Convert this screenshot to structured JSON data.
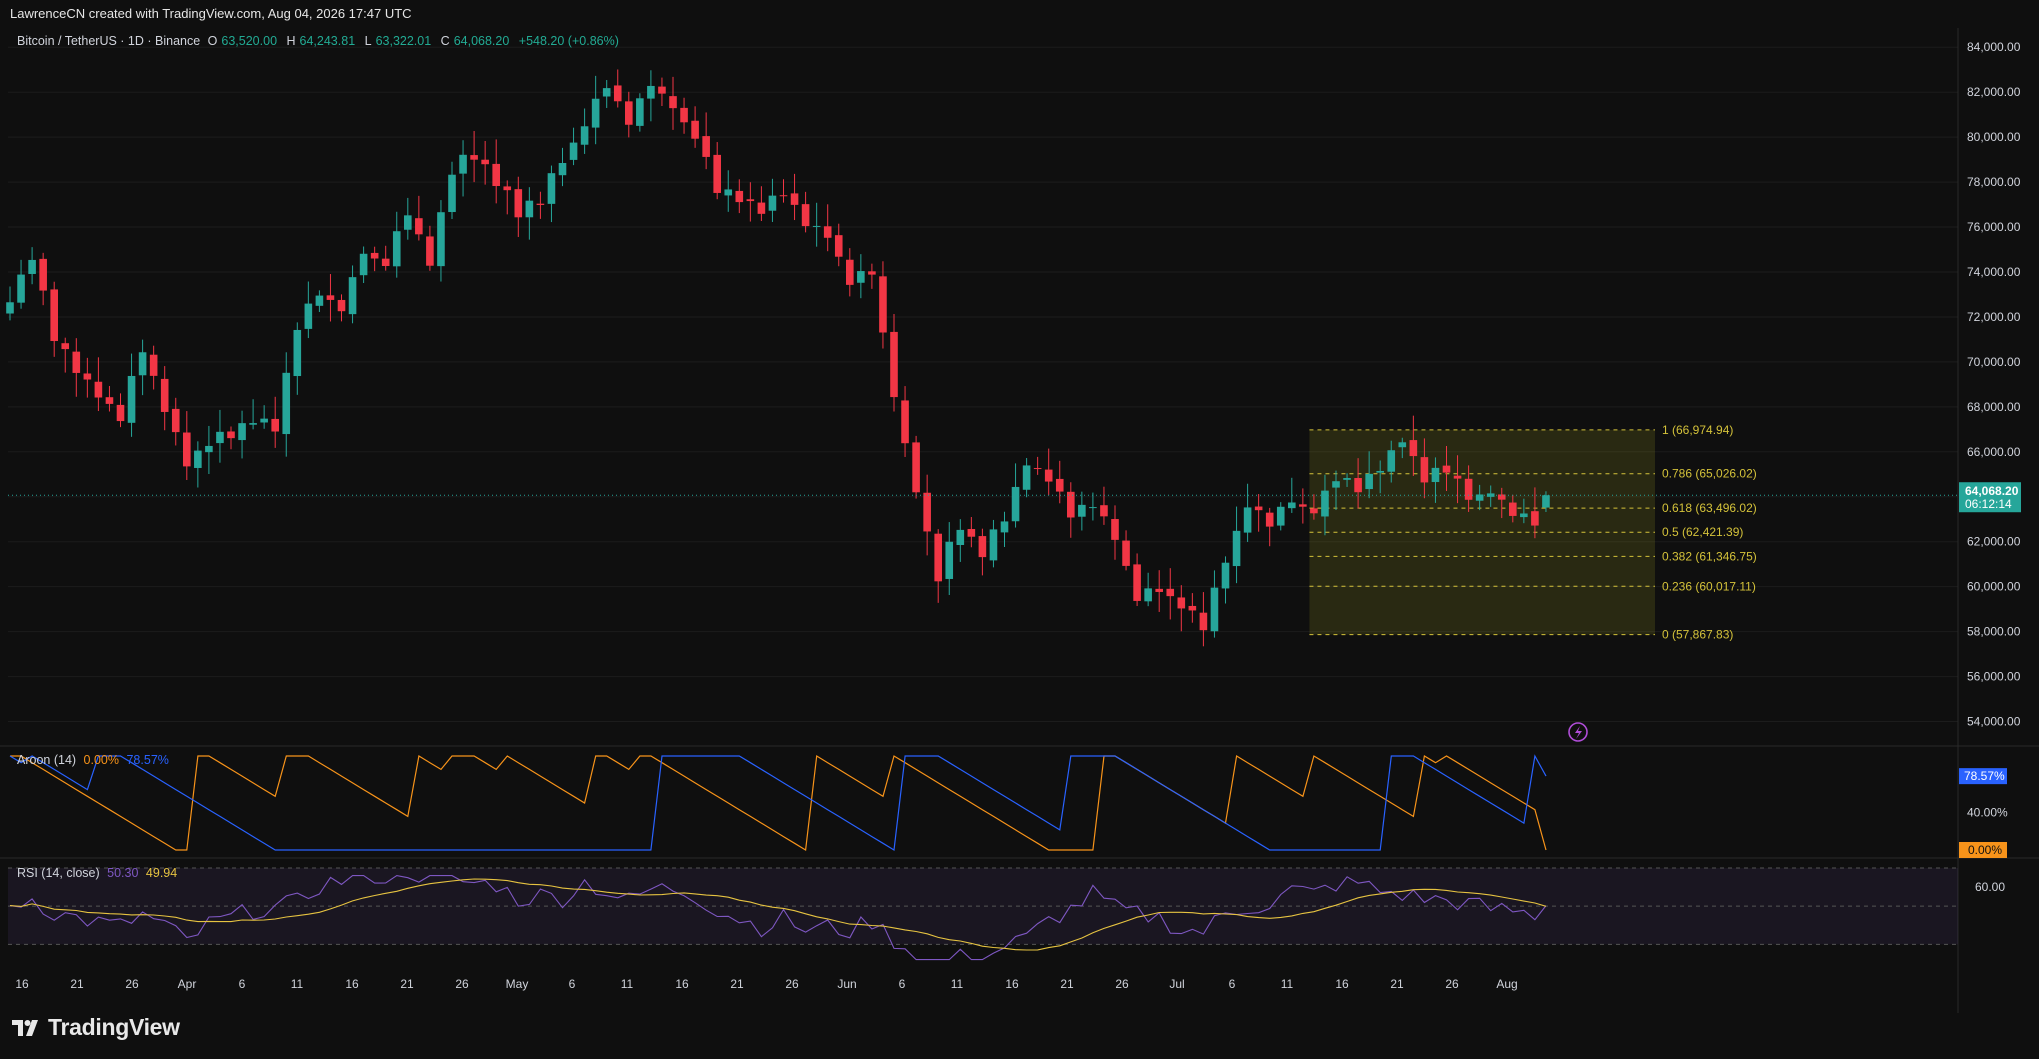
{
  "header": {
    "attribution": "LawrenceCN created with TradingView.com, Aug 04, 2026 17:47 UTC"
  },
  "legend": {
    "symbol": "Bitcoin / TetherUS · 1D · Binance",
    "open_label": "O",
    "open": "63,520.00",
    "high_label": "H",
    "high": "64,243.81",
    "low_label": "L",
    "low": "63,322.01",
    "close_label": "C",
    "close": "64,068.20",
    "change": "+548.20 (+0.86%)"
  },
  "price_badge": {
    "price": "64,068.20",
    "countdown": "06:12:14"
  },
  "aroon": {
    "label": "Aroon (14)",
    "up_value": "0.00%",
    "down_value": "78.57%",
    "axis_label": "40.00%",
    "badge_down": "78.57%",
    "badge_up": "0.00%"
  },
  "rsi": {
    "label": "RSI (14, close)",
    "rsi_value": "50.30",
    "ma_value": "49.94",
    "axis_label": "60.00"
  },
  "logo": {
    "text": "TradingView"
  },
  "colors": {
    "up": "#26a69a",
    "down": "#f23645",
    "aroon_up": "#f7931a",
    "aroon_down": "#2962ff",
    "rsi": "#7e57c2",
    "rsi_ma": "#e6c341",
    "fib": "#d4c23a"
  },
  "chart_data": [
    {
      "type": "candlestick",
      "title": "Bitcoin / TetherUS · 1D · Binance",
      "ylim": [
        53000,
        84500
      ],
      "y_ticks": [
        "84,000.00",
        "82,000.00",
        "80,000.00",
        "78,000.00",
        "76,000.00",
        "74,000.00",
        "72,000.00",
        "70,000.00",
        "68,000.00",
        "66,000.00",
        "62,000.00",
        "60,000.00",
        "58,000.00",
        "56,000.00",
        "54,000.00"
      ],
      "x_ticks": [
        "16",
        "21",
        "26",
        "Apr",
        "6",
        "11",
        "16",
        "21",
        "26",
        "May",
        "6",
        "11",
        "16",
        "21",
        "26",
        "Jun",
        "6",
        "11",
        "16",
        "21",
        "26",
        "Jul",
        "6",
        "11",
        "16",
        "21",
        "26",
        "Aug"
      ],
      "close_anchors": [
        {
          "d": 0,
          "c": 72800
        },
        {
          "d": 2,
          "c": 74800
        },
        {
          "d": 4,
          "c": 71000
        },
        {
          "d": 6,
          "c": 69800
        },
        {
          "d": 8,
          "c": 68500
        },
        {
          "d": 10,
          "c": 67600
        },
        {
          "d": 12,
          "c": 70500
        },
        {
          "d": 14,
          "c": 67800
        },
        {
          "d": 16,
          "c": 65500
        },
        {
          "d": 18,
          "c": 66300
        },
        {
          "d": 20,
          "c": 66800
        },
        {
          "d": 22,
          "c": 67500
        },
        {
          "d": 24,
          "c": 67200
        },
        {
          "d": 26,
          "c": 71500
        },
        {
          "d": 28,
          "c": 73200
        },
        {
          "d": 30,
          "c": 72300
        },
        {
          "d": 32,
          "c": 74900
        },
        {
          "d": 34,
          "c": 74300
        },
        {
          "d": 36,
          "c": 76800
        },
        {
          "d": 38,
          "c": 74300
        },
        {
          "d": 40,
          "c": 78600
        },
        {
          "d": 42,
          "c": 79200
        },
        {
          "d": 44,
          "c": 78100
        },
        {
          "d": 46,
          "c": 76600
        },
        {
          "d": 48,
          "c": 77200
        },
        {
          "d": 50,
          "c": 78900
        },
        {
          "d": 52,
          "c": 80600
        },
        {
          "d": 54,
          "c": 82300
        },
        {
          "d": 56,
          "c": 80600
        },
        {
          "d": 58,
          "c": 82500
        },
        {
          "d": 60,
          "c": 81300
        },
        {
          "d": 62,
          "c": 80000
        },
        {
          "d": 64,
          "c": 77800
        },
        {
          "d": 66,
          "c": 77400
        },
        {
          "d": 68,
          "c": 76800
        },
        {
          "d": 70,
          "c": 77500
        },
        {
          "d": 72,
          "c": 76200
        },
        {
          "d": 74,
          "c": 75800
        },
        {
          "d": 76,
          "c": 73500
        },
        {
          "d": 78,
          "c": 73900
        },
        {
          "d": 80,
          "c": 68500
        },
        {
          "d": 82,
          "c": 64200
        },
        {
          "d": 84,
          "c": 60500
        },
        {
          "d": 86,
          "c": 62800
        },
        {
          "d": 88,
          "c": 61600
        },
        {
          "d": 90,
          "c": 63000
        },
        {
          "d": 92,
          "c": 65500
        },
        {
          "d": 94,
          "c": 64800
        },
        {
          "d": 96,
          "c": 63300
        },
        {
          "d": 98,
          "c": 63800
        },
        {
          "d": 100,
          "c": 62300
        },
        {
          "d": 102,
          "c": 59500
        },
        {
          "d": 104,
          "c": 60000
        },
        {
          "d": 106,
          "c": 59100
        },
        {
          "d": 108,
          "c": 58300
        },
        {
          "d": 110,
          "c": 61200
        },
        {
          "d": 112,
          "c": 63600
        },
        {
          "d": 114,
          "c": 62700
        },
        {
          "d": 116,
          "c": 63800
        },
        {
          "d": 118,
          "c": 63300
        },
        {
          "d": 120,
          "c": 64900
        },
        {
          "d": 122,
          "c": 64300
        },
        {
          "d": 124,
          "c": 65200
        },
        {
          "d": 126,
          "c": 66700
        },
        {
          "d": 128,
          "c": 64700
        },
        {
          "d": 130,
          "c": 65300
        },
        {
          "d": 132,
          "c": 63900
        },
        {
          "d": 134,
          "c": 64200
        },
        {
          "d": 136,
          "c": 63200
        },
        {
          "d": 138,
          "c": 62900
        },
        {
          "d": 139,
          "c": 64068
        }
      ],
      "fib_levels": [
        {
          "ratio": "1",
          "label": "1 (66,974.94)",
          "price": 66974.94
        },
        {
          "ratio": "0.786",
          "label": "0.786 (65,026.02)",
          "price": 65026.02
        },
        {
          "ratio": "0.618",
          "label": "0.618 (63,496.02)",
          "price": 63496.02
        },
        {
          "ratio": "0.5",
          "label": "0.5 (62,421.39)",
          "price": 62421.39
        },
        {
          "ratio": "0.382",
          "label": "0.382 (61,346.75)",
          "price": 61346.75
        },
        {
          "ratio": "0.236",
          "label": "0.236 (60,017.11)",
          "price": 60017.11
        },
        {
          "ratio": "0",
          "label": "0 (57,867.83)",
          "price": 57867.83
        }
      ],
      "fib_range_days": [
        109,
        139
      ],
      "last_price": 64068.2
    },
    {
      "type": "line",
      "title": "Aroon (14)",
      "ylim": [
        0,
        100
      ],
      "series": [
        {
          "name": "Aroon Up",
          "last": 0.0
        },
        {
          "name": "Aroon Down",
          "last": 78.57
        }
      ]
    },
    {
      "type": "line",
      "title": "RSI (14, close)",
      "ylim": [
        15,
        70
      ],
      "bands": [
        70,
        50,
        30
      ],
      "series": [
        {
          "name": "RSI",
          "last": 50.3
        },
        {
          "name": "RSI MA",
          "last": 49.94
        }
      ]
    }
  ]
}
